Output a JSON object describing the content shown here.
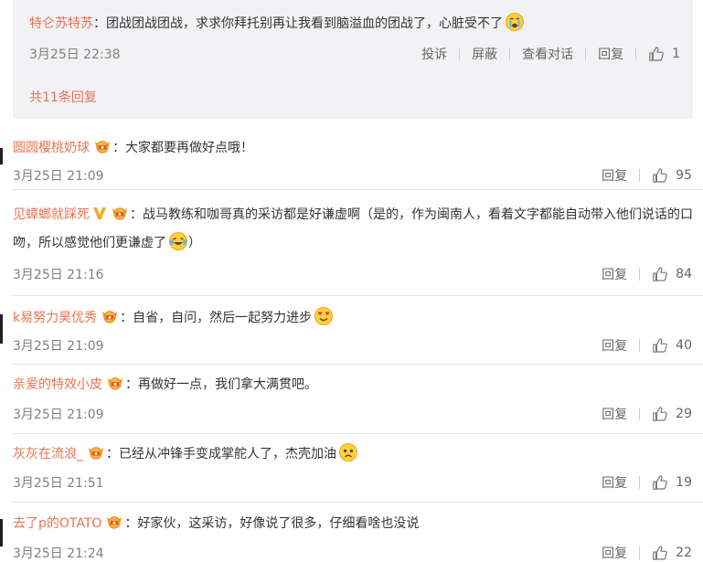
{
  "reply_thread": {
    "reply": {
      "user": "特仑苏特苏",
      "text": "：团战团战团战，求求你拜托别再让我看到脑溢血的团战了，心脏受不了",
      "emoji": "crying-face-icon",
      "date": "3月25日 22:38",
      "actions": [
        "投诉",
        "屏蔽",
        "查看对话",
        "回复"
      ],
      "likes": "1"
    },
    "total_replies": "共11条回复"
  },
  "reply_label": "回复",
  "comments": [
    {
      "user": "圆圆樱桃奶球",
      "text": "：大家都要再做好点哦！",
      "date": "3月25日 21:09",
      "likes": "95"
    },
    {
      "user": "见蟑螂就踩死",
      "text": "：战马教练和咖哥真的采访都是好谦虚啊（是的，作为闽南人，看着文字都能自动带入他们说话的口吻，所以感觉他们更谦虚了",
      "text_end": "）",
      "date": "3月25日 21:16",
      "likes": "84"
    },
    {
      "user": "k易努力昊优秀",
      "text": "：自省，自问，然后一起努力进步",
      "date": "3月25日 21:09",
      "likes": "40"
    },
    {
      "user": "亲爱的特效小皮",
      "text": "：再做好一点，我们拿大满贯吧。",
      "date": "3月25日 21:09",
      "likes": "29"
    },
    {
      "user": "灰灰在流浪_",
      "text": "：已经从冲锋手变成掌舵人了，杰壳加油",
      "date": "3月25日 21:51",
      "likes": "19"
    },
    {
      "user": "去了p的OTATO",
      "text": "：好家伙，这采访，好像说了很多，仔细看啥也没说",
      "date": "3月25日 21:24",
      "likes": "22"
    }
  ],
  "colors": {
    "username": "#eb7350",
    "meta": "#808080",
    "reply_bg": "#f2f2f5"
  }
}
